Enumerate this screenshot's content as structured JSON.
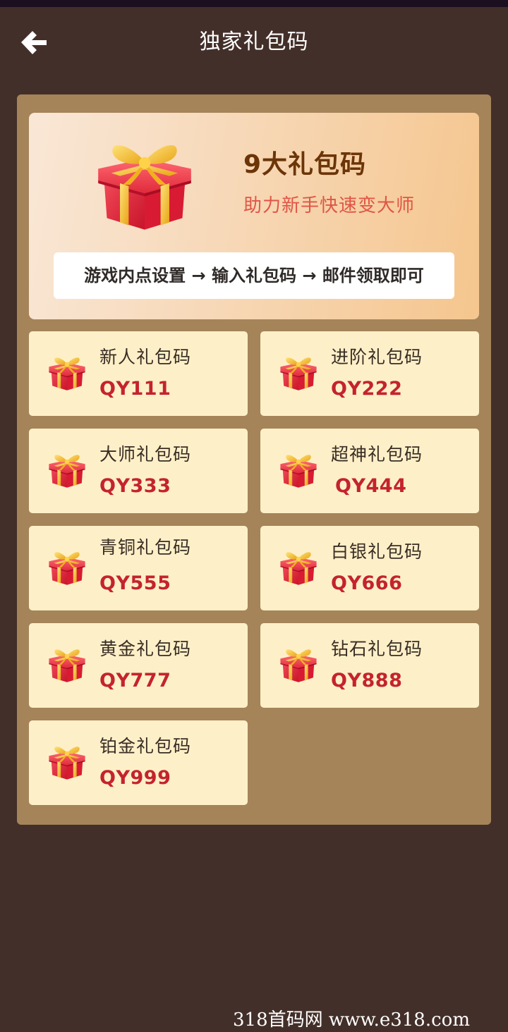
{
  "header": {
    "title": "独家礼包码",
    "back_icon": "arrow-left-icon"
  },
  "banner": {
    "title": "9大礼包码",
    "subtitle": "助力新手快速变大师",
    "instructions": "游戏内点设置 → 输入礼包码 → 邮件领取即可",
    "icon": "gift-box-icon"
  },
  "codes": [
    {
      "label": "新人礼包码",
      "code": "QY111"
    },
    {
      "label": "进阶礼包码",
      "code": "QY222"
    },
    {
      "label": "大师礼包码",
      "code": "QY333"
    },
    {
      "label": "超神礼包码",
      "code": "QY444"
    },
    {
      "label": "青铜礼包码",
      "code": "QY555"
    },
    {
      "label": "白银礼包码",
      "code": "QY666"
    },
    {
      "label": "黄金礼包码",
      "code": "QY777"
    },
    {
      "label": "钻石礼包码",
      "code": "QY888"
    },
    {
      "label": "铂金礼包码",
      "code": "QY999"
    }
  ],
  "watermark": "318首码网  www.e318.com",
  "colors": {
    "background": "#432f29",
    "panel": "#a5845a",
    "card": "#fdf0c8",
    "code_text": "#c4232d",
    "banner_title": "#6b3508",
    "banner_subtitle": "#e05546"
  }
}
